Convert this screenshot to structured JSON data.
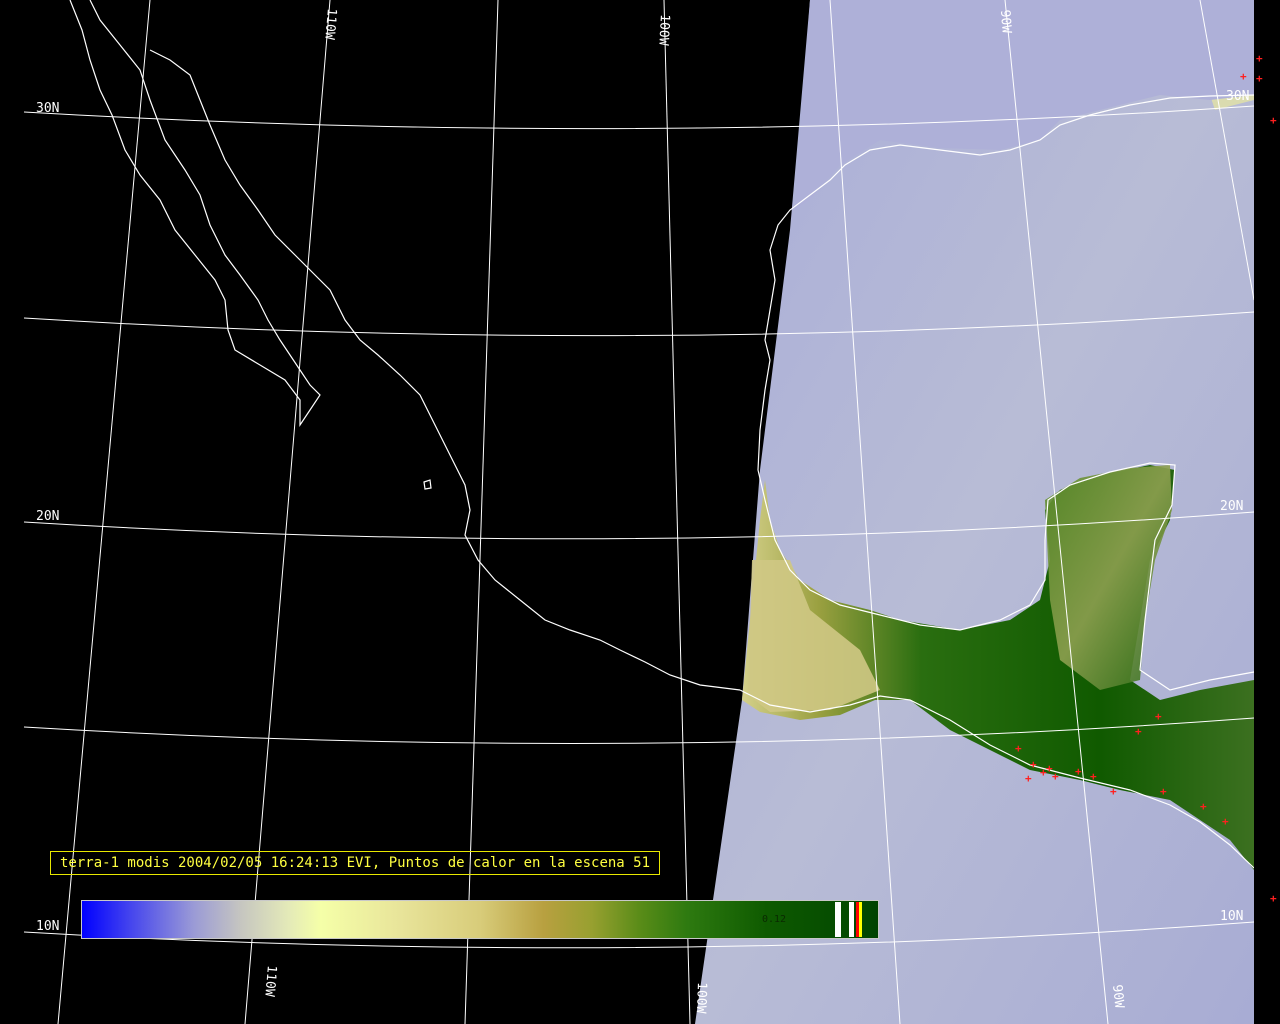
{
  "caption": "terra-1 modis 2004/02/05 16:24:13 EVI, Puntos de calor en la escena 51",
  "colorbar": {
    "value_label": "0.12"
  },
  "grid_labels": {
    "lat30": "30N",
    "lat20": "20N",
    "lat10": "10N",
    "lat20_right": "20N",
    "lat10_right": "10N",
    "lat30_right": "30N",
    "lon110_top": "110W",
    "lon100_top": "100W",
    "lon90_top": "90W",
    "lon110_bottom": "110W",
    "lon100_bottom": "100W",
    "lon90_bottom": "90W"
  },
  "colors": {
    "grid": "#ffffff",
    "coast": "#ffffff",
    "caption": "#ffff40",
    "hotspot": "#ff2020",
    "ocean": "#b4b8d8",
    "vegetation": "#1c6a10",
    "dry": "#d8d28e"
  }
}
